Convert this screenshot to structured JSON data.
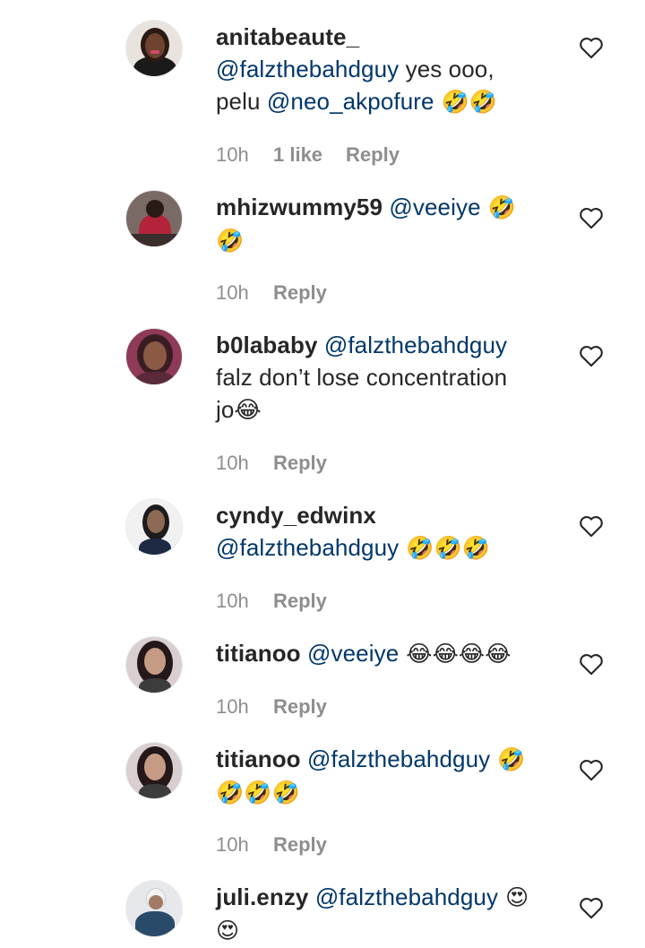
{
  "comments": [
    {
      "username": "anitabeaute_",
      "line1": "",
      "line1_mention": "@falzthebahdguy",
      "line1_tail": " yes ooo,",
      "line2": "pelu ",
      "line2_mention": "@neo_akpofure",
      "line2_tail": " 🤣🤣",
      "time": "10h",
      "likes": "1 like",
      "reply": "Reply"
    },
    {
      "username": "mhizwummy59",
      "mention": "@veeiye",
      "tail1": " 🤣",
      "line2": "🤣",
      "time": "10h",
      "reply": "Reply"
    },
    {
      "username": "b0lababy",
      "mention": "@falzthebahdguy",
      "line2": "falz don’t lose concentration",
      "line3": "jo😂",
      "time": "10h",
      "reply": "Reply"
    },
    {
      "username": "cyndy_edwinx",
      "mention": "@falzthebahdguy",
      "tail": " 🤣🤣🤣",
      "time": "10h",
      "reply": "Reply"
    },
    {
      "username": "titianoo",
      "mention": "@veeiye",
      "tail": " 😂😂😂😂",
      "time": "10h",
      "reply": "Reply"
    },
    {
      "username": "titianoo",
      "mention": "@falzthebahdguy",
      "tail1": " 🤣",
      "line2": "🤣🤣🤣",
      "time": "10h",
      "reply": "Reply"
    },
    {
      "username": "juli.enzy",
      "mention": "@falzthebahdguy",
      "tail1": " 😍",
      "line2": "😍"
    }
  ],
  "colors": {
    "username": "#262626",
    "mention": "#00376b",
    "meta": "#8e8e8e"
  },
  "icons": {
    "like": "heart-outline-icon"
  }
}
